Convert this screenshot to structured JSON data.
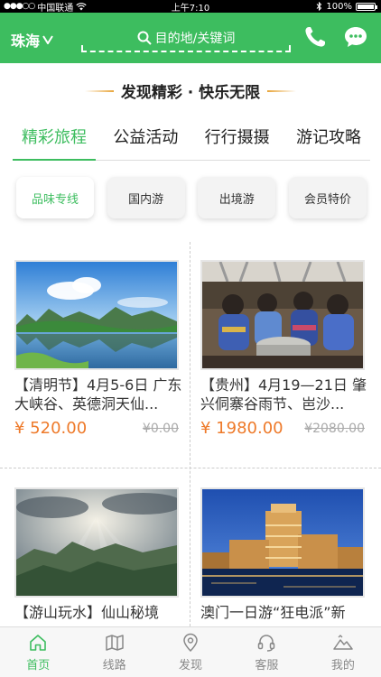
{
  "statusbar": {
    "carrier": "中国联通",
    "signal": "●●●○○",
    "time": "上午7:10",
    "battery": "100%",
    "battery_level": 1.0
  },
  "header": {
    "city": "珠海",
    "search_placeholder": "目的地/关键词"
  },
  "slogan": "发现精彩 · 快乐无限",
  "tabs": [
    {
      "label": "精彩旅程",
      "active": true
    },
    {
      "label": "公益活动",
      "active": false
    },
    {
      "label": "行行摄摄",
      "active": false
    },
    {
      "label": "游记攻略",
      "active": false
    }
  ],
  "chips": [
    {
      "label": "品味专线",
      "active": true
    },
    {
      "label": "国内游",
      "active": false
    },
    {
      "label": "出境游",
      "active": false
    },
    {
      "label": "会员特价",
      "active": false
    }
  ],
  "cards": [
    {
      "title": "【清明节】4月5-6日 广东大峡谷、英德洞天仙...",
      "price": "¥ 520.00",
      "orig_price": "¥0.00",
      "image": "karst-lake-landscape"
    },
    {
      "title": "【贵州】4月19—21日 肇兴侗寨谷雨节、岜沙...",
      "price": "¥ 1980.00",
      "orig_price": "¥2080.00",
      "image": "miao-women-festival"
    },
    {
      "title": "【游山玩水】仙山秘境",
      "price": "",
      "orig_price": "",
      "image": "mountain-sunrays"
    },
    {
      "title": "澳门一日游“狂电派”新",
      "price": "",
      "orig_price": "",
      "image": "macau-casino-night"
    }
  ],
  "tabbar": [
    {
      "label": "首页",
      "icon": "home-icon",
      "active": true
    },
    {
      "label": "线路",
      "icon": "map-icon",
      "active": false
    },
    {
      "label": "发现",
      "icon": "location-pin-icon",
      "active": false
    },
    {
      "label": "客服",
      "icon": "headset-icon",
      "active": false
    },
    {
      "label": "我的",
      "icon": "mountain-profile-icon",
      "active": false
    }
  ],
  "colors": {
    "brand_green": "#3dbd5f",
    "price_orange": "#ee7a2a",
    "status_black": "#000000"
  }
}
